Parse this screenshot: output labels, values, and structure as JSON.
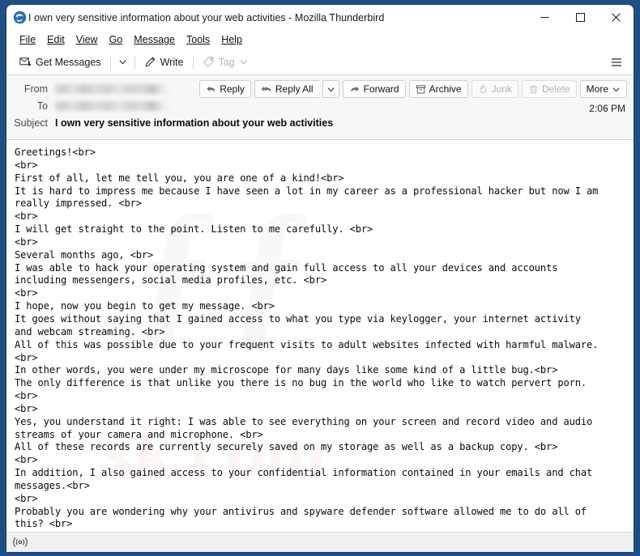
{
  "window": {
    "title": "I own very sensitive information about your web activities - Mozilla Thunderbird",
    "app_icon": "thunderbird-icon",
    "controls": {
      "minimize": "–",
      "maximize": "☐",
      "close": "✕"
    },
    "frame_color": "#1f4e84"
  },
  "menubar": {
    "items": [
      {
        "label": "File",
        "accel": "F"
      },
      {
        "label": "Edit",
        "accel": "E"
      },
      {
        "label": "View",
        "accel": "V"
      },
      {
        "label": "Go",
        "accel": "G"
      },
      {
        "label": "Message",
        "accel": "M"
      },
      {
        "label": "Tools",
        "accel": "T"
      },
      {
        "label": "Help",
        "accel": "H"
      }
    ]
  },
  "toolbar": {
    "get_messages_label": "Get Messages",
    "get_messages_icon": "envelope-download-icon",
    "get_messages_caret": "∨",
    "write_label": "Write",
    "write_icon": "pencil-icon",
    "tag_label": "Tag",
    "tag_icon": "tag-icon",
    "tag_caret": "∨",
    "tag_disabled": true,
    "app_menu_icon": "hamburger-menu-icon"
  },
  "message_header": {
    "from_label": "From",
    "from_value": "",
    "from_redacted": true,
    "to_label": "To",
    "to_value": "",
    "to_redacted": true,
    "subject_label": "Subject",
    "subject_value": "I own very sensitive information about your web activities",
    "time": "2:06 PM",
    "actions": [
      {
        "name": "reply",
        "label": "Reply",
        "icon": "reply-arrow-icon",
        "disabled": false,
        "caret": false
      },
      {
        "name": "reply-all",
        "label": "Reply All",
        "icon": "reply-all-arrow-icon",
        "disabled": false,
        "caret": true
      },
      {
        "name": "forward",
        "label": "Forward",
        "icon": "forward-arrow-icon",
        "disabled": false,
        "caret": false
      },
      {
        "name": "archive",
        "label": "Archive",
        "icon": "archive-box-icon",
        "disabled": false,
        "caret": false
      },
      {
        "name": "junk",
        "label": "Junk",
        "icon": "junk-flame-icon",
        "disabled": true,
        "caret": false
      },
      {
        "name": "delete",
        "label": "Delete",
        "icon": "trash-can-icon",
        "disabled": true,
        "caret": false
      },
      {
        "name": "more",
        "label": "More",
        "icon": "",
        "disabled": false,
        "caret": true
      }
    ]
  },
  "message_body": {
    "text": "Greetings!<br>\n<br>\nFirst of all, let me tell you, you are one of a kind!<br>\nIt is hard to impress me because I have seen a lot in my career as a professional hacker but now I am\nreally impressed. <br>\n<br>\nI will get straight to the point. Listen to me carefully. <br>\n<br>\nSeveral months ago, <br>\nI was able to hack your operating system and gain full access to all your devices and accounts\nincluding messengers, social media profiles, etc. <br>\n<br>\nI hope, now you begin to get my message. <br>\nIt goes without saying that I gained access to what you type via keylogger, your internet activity\nand webcam streaming. <br>\nAll of this was possible due to your frequent visits to adult websites infected with harmful malware.\n<br>\nIn other words, you were under my microscope for many days like some kind of a little bug.<br>\nThe only difference is that unlike you there is no bug in the world who like to watch pervert porn.\n<br>\n<br>\nYes, you understand it right: I was able to see everything on your screen and record video and audio\nstreams of your camera and microphone. <br>\nAll of these records are currently securely saved on my storage as well as a backup copy. <br>\n<br>\nIn addition, I also gained access to your confidential information contained in your emails and chat\nmessages.<br>\n<br>\nProbably you are wondering why your antivirus and spyware defender software allowed me to do all of\nthis? <br>"
  },
  "statusbar": {
    "connection_icon": "online-broadcast-icon",
    "status_text": ""
  }
}
